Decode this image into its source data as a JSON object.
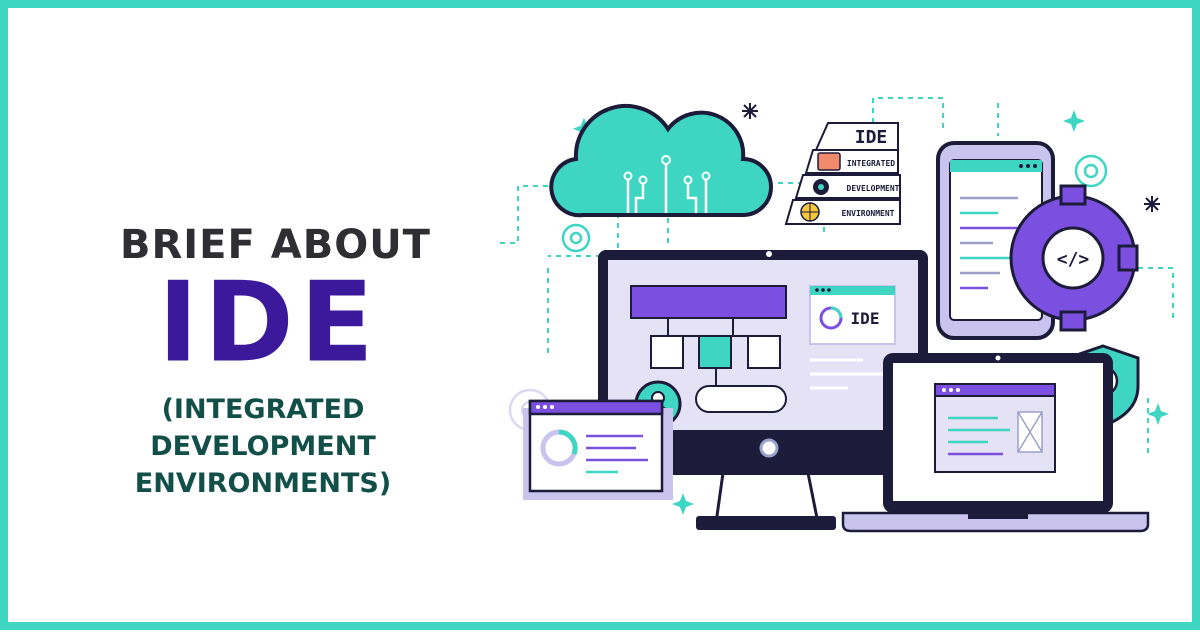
{
  "headline": {
    "line1": "BRIEF ABOUT",
    "line2": "IDE",
    "line3a": "(INTEGRATED DEVELOPMENT",
    "line3b": "ENVIRONMENTS)"
  },
  "illustration": {
    "pyramid_title": "IDE",
    "pyramid_items": [
      "INTEGRATED",
      "DEVELOPMENT",
      "ENVIRONMENT"
    ],
    "monitor_card_title": "IDE",
    "code_tag": "</>",
    "icons": [
      "cloud-icon",
      "gear-icon",
      "user-icon",
      "shield-check-icon",
      "globe-icon",
      "sparkle-icon"
    ]
  },
  "colors": {
    "border": "#3ed6c3",
    "teal": "#3ed6c3",
    "purple": "#7b4fe0",
    "deep_purple": "#3a1a9a",
    "dark_navy": "#1d1b3a",
    "lavender": "#c9c3ee",
    "headline_dark": "#2e2e33",
    "headline_green": "#124f48"
  }
}
